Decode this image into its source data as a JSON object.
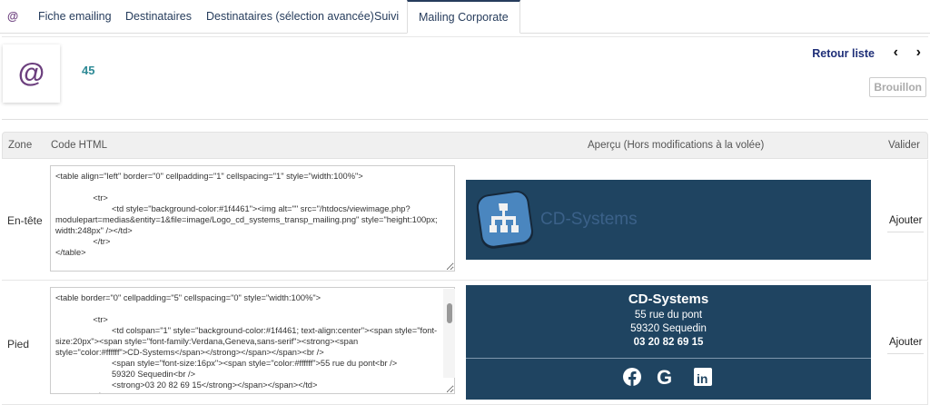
{
  "tabs": [
    "@",
    "Fiche emailing",
    "Destinataires",
    "Destinataires (sélection avancée)",
    "Suivi",
    "Mailing Corporate"
  ],
  "header": {
    "ref": "45",
    "back": "Retour liste",
    "prev": "‹",
    "next": "›",
    "status": "Brouillon",
    "logo": "@"
  },
  "table": {
    "cols": [
      "Zone",
      "Code HTML",
      "Aperçu (Hors modifications à la volée)",
      "Valider"
    ],
    "rows": [
      {
        "zone": "En-tête",
        "code": "<table align=\"left\" border=\"0\" cellpadding=\"1\" cellspacing=\"1\" style=\"width:100%\">\n\n\t\t<tr>\n\t\t\t<td style=\"background-color:#1f4461\"><img alt=\"\" src=\"/htdocs/viewimage.php?modulepart=medias&entity=1&file=image/Logo_cd_systems_transp_mailing.png\" style=\"height:100px; width:248px\" /></td>\n\t\t</tr>\n</table>",
        "preview_text": "CD-Systems",
        "action": "Ajouter"
      },
      {
        "zone": "Pied",
        "code": "<table border=\"0\" cellpadding=\"5\" cellspacing=\"0\" style=\"width:100%\">\n\n\t\t<tr>\n\t\t\t<td colspan=\"1\" style=\"background-color:#1f4461; text-align:center\"><span style=\"font-size:20px\"><span style=\"font-family:Verdana,Geneva,sans-serif\"><strong><span style=\"color:#ffffff\">CD-Systems</span></strong></span></span><br />\n\t\t\t<span style=\"font-size:16px\"><span style=\"color:#ffffff\">55 rue du pont<br />\n\t\t\t59320 Sequedin<br />\n\t\t\t<strong>03 20 82 69 15</strong></span></span></td>\n\t\t</tr>",
        "preview": {
          "name": "CD-Systems",
          "street": "55 rue du pont",
          "city": "59320 Sequedin",
          "phone": "03 20 82 69 15",
          "social": [
            "facebook",
            "google",
            "linkedin"
          ]
        },
        "action": "Ajouter"
      }
    ]
  },
  "colors": {
    "brand": "#1f4461",
    "accent": "#263c5c"
  }
}
